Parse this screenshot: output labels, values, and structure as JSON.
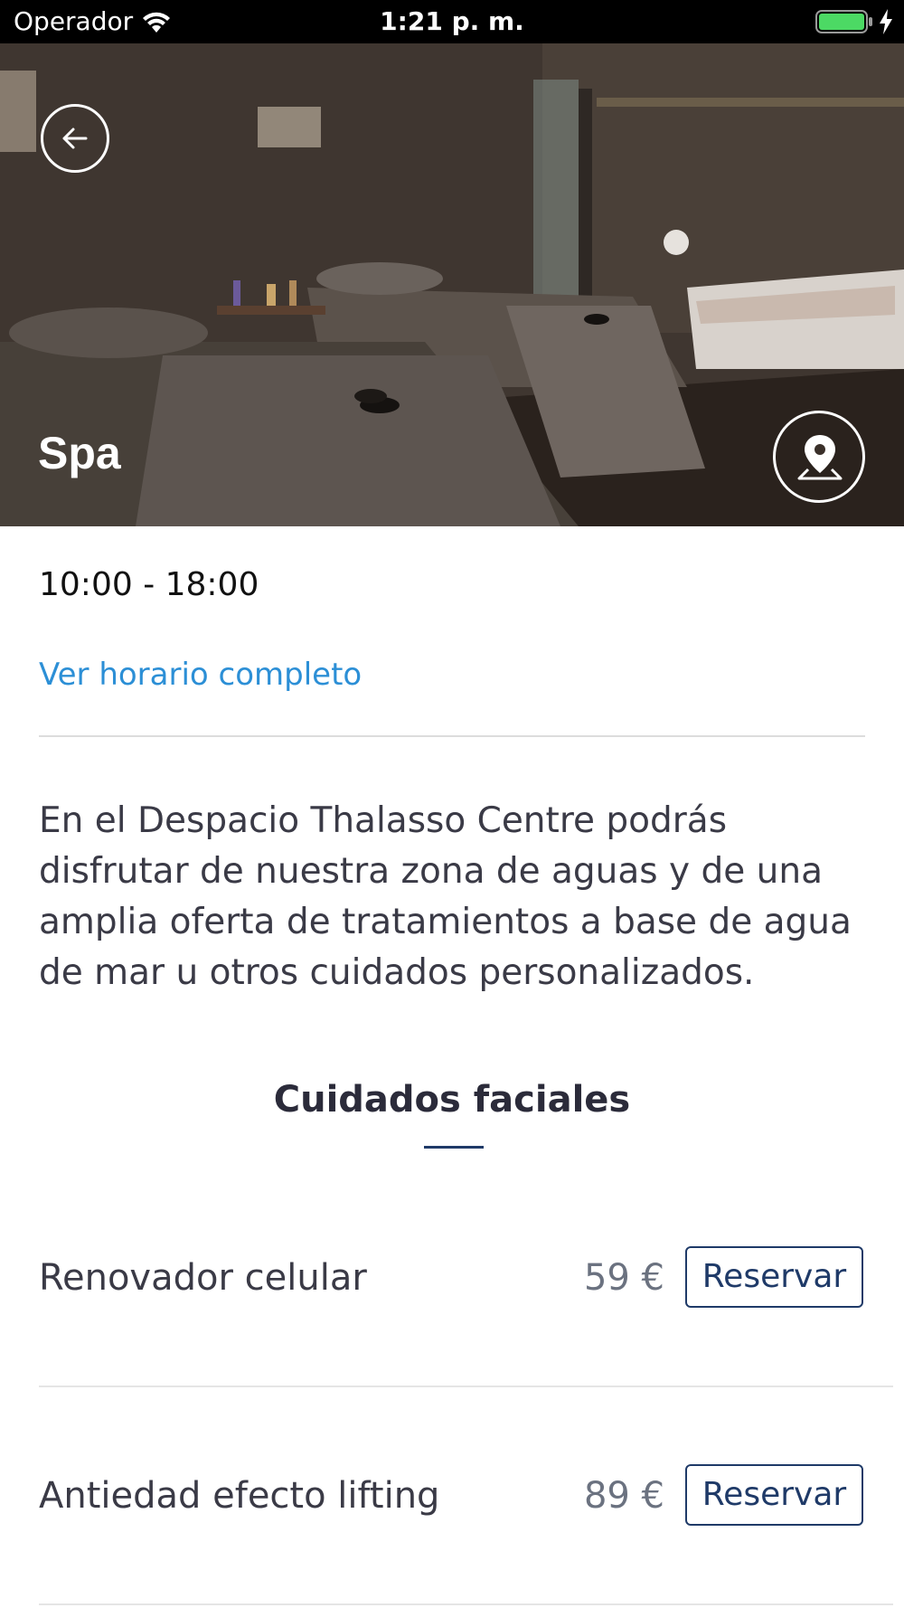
{
  "status_bar": {
    "carrier": "Operador",
    "time": "1:21 p. m.",
    "battery_color": "#4cd964"
  },
  "hero": {
    "title": "Spa",
    "back_icon": "arrow-left-icon",
    "map_icon": "map-pin-icon"
  },
  "info": {
    "hours": "10:00 - 18:00",
    "schedule_link": "Ver horario completo",
    "link_color": "#2c8fd6"
  },
  "description": "En el Despacio Thalasso Centre podrás disfrutar de nuestra zona de aguas y de  una amplia oferta de tratamientos a base de agua de mar u otros cuidados personalizados.",
  "section": {
    "title": "Cuidados faciales",
    "accent_color": "#1f3a68"
  },
  "services": [
    {
      "name": "Renovador celular",
      "price": "59 €",
      "button_label": "Reservar"
    },
    {
      "name": "Antiedad efecto lifting",
      "price": "89 €",
      "button_label": "Reservar"
    }
  ]
}
